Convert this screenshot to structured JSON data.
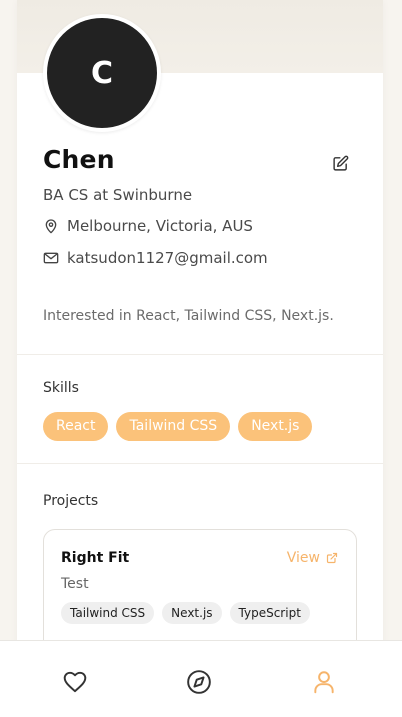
{
  "profile": {
    "avatar_initial": "C",
    "name": "Chen",
    "subtitle": "BA CS at Swinburne",
    "location": "Melbourne, Victoria, AUS",
    "email": "katsudon1127@gmail.com",
    "bio": "Interested in React, Tailwind CSS, Next.js."
  },
  "skills": {
    "title": "Skills",
    "items": [
      "React",
      "Tailwind CSS",
      "Next.js"
    ]
  },
  "projects": {
    "title": "Projects",
    "items": [
      {
        "title": "Right Fit",
        "view_label": "View",
        "description": "Test",
        "tags": [
          "Tailwind CSS",
          "Next.js",
          "TypeScript"
        ]
      }
    ]
  },
  "nav": {
    "items": [
      {
        "icon": "heart-icon",
        "active": false
      },
      {
        "icon": "compass-icon",
        "active": false
      },
      {
        "icon": "user-icon",
        "active": true
      }
    ]
  },
  "colors": {
    "accent": "#f6b46b",
    "chip_bg": "#fbc27a",
    "avatar_bg": "#222222",
    "nav_inactive": "#333333"
  }
}
